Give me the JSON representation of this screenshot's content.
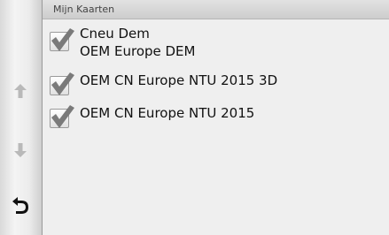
{
  "header": {
    "title": "Mijn Kaarten"
  },
  "nav": {
    "up_icon": "arrow-up-icon",
    "down_icon": "arrow-down-icon",
    "back_icon": "back-arrow-icon"
  },
  "maps": [
    {
      "lines": [
        "Cneu Dem",
        "OEM Europe DEM"
      ],
      "checked": true
    },
    {
      "lines": [
        "OEM CN Europe NTU 2015 3D"
      ],
      "checked": true
    },
    {
      "lines": [
        "OEM CN Europe NTU 2015"
      ],
      "checked": true
    }
  ]
}
